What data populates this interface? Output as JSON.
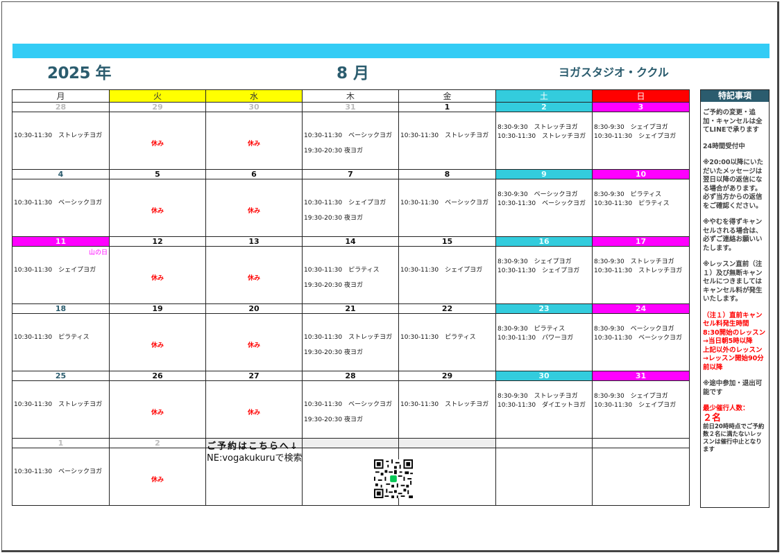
{
  "header": {
    "year": "2025 年",
    "month": "8 月",
    "studio": "ヨガスタジオ・ククル"
  },
  "weekdays": [
    "月",
    "火",
    "水",
    "木",
    "金",
    "土",
    "日"
  ],
  "weeks": [
    {
      "dates": [
        "28",
        "29",
        "30",
        "31",
        "1",
        "2",
        "3"
      ],
      "holiday": "",
      "cells": [
        {
          "l1": "10:30-11:30　ストレッチヨガ"
        },
        {
          "rest": "休み"
        },
        {
          "rest": "休み"
        },
        {
          "l1": "10:30-11:30　ベーシックヨガ",
          "l2": "19:30-20:30 夜ヨガ"
        },
        {
          "l1": "10:30-11:30　ストレッチヨガ"
        },
        {
          "w1": "8:30-9:30　ストレッチヨガ",
          "w2": "10:30-11:30　ストレッチヨガ"
        },
        {
          "w1": "8:30-9:30　シェイプヨガ",
          "w2": "10:30-11:30　シェイプヨガ"
        }
      ]
    },
    {
      "dates": [
        "4",
        "5",
        "6",
        "7",
        "8",
        "9",
        "10"
      ],
      "holiday": "",
      "cells": [
        {
          "l1": "10:30-11:30　ベーシックヨガ"
        },
        {
          "rest": "休み"
        },
        {
          "rest": "休み"
        },
        {
          "l1": "10:30-11:30　シェイプヨガ",
          "l2": "19:30-20:30 夜ヨガ"
        },
        {
          "l1": "10:30-11:30　ベーシックヨガ"
        },
        {
          "w1": "8:30-9:30　ベーシックヨガ",
          "w2": "10:30-11:30　ベーシックヨガ"
        },
        {
          "w1": "8:30-9:30　ピラティス",
          "w2": "10:30-11:30　ピラティス"
        }
      ]
    },
    {
      "dates": [
        "11",
        "12",
        "13",
        "14",
        "15",
        "16",
        "17"
      ],
      "holiday": "山の日",
      "cells": [
        {
          "l1": "10:30-11:30　シェイプヨガ"
        },
        {
          "rest": "休み"
        },
        {
          "rest": "休み"
        },
        {
          "l1": "10:30-11:30　ピラティス",
          "l2": "19:30-20:30 夜ヨガ"
        },
        {
          "l1": "10:30-11:30　シェイプヨガ"
        },
        {
          "w1": "8:30-9:30　シェイプヨガ",
          "w2": "10:30-11:30　シェイプヨガ"
        },
        {
          "w1": "8:30-9:30　ストレッチヨガ",
          "w2": "10:30-11:30　ストレッチヨガ"
        }
      ]
    },
    {
      "dates": [
        "18",
        "19",
        "20",
        "21",
        "22",
        "23",
        "24"
      ],
      "holiday": "",
      "cells": [
        {
          "l1": "10:30-11:30　ピラティス"
        },
        {
          "rest": "休み"
        },
        {
          "rest": "休み"
        },
        {
          "l1": "10:30-11:30　ストレッチヨガ",
          "l2": "19:30-20:30 夜ヨガ"
        },
        {
          "l1": "10:30-11:30　ピラティス"
        },
        {
          "w1": "8:30-9:30　ピラティス",
          "w2": "10:30-11:30　パワーヨガ"
        },
        {
          "w1": "8:30-9:30　ベーシックヨガ",
          "w2": "10:30-11:30　ベーシックヨガ"
        }
      ]
    },
    {
      "dates": [
        "25",
        "26",
        "27",
        "28",
        "29",
        "30",
        "31"
      ],
      "holiday": "",
      "cells": [
        {
          "l1": "10:30-11:30　ストレッチヨガ"
        },
        {
          "rest": "休み"
        },
        {
          "rest": "休み"
        },
        {
          "l1": "10:30-11:30　ベーシックヨガ",
          "l2": "19:30-20:30 夜ヨガ"
        },
        {
          "l1": "10:30-11:30　ストレッチヨガ"
        },
        {
          "w1": "8:30-9:30　ストレッチヨガ",
          "w2": "10:30-11:30　ダイエットヨガ"
        },
        {
          "w1": "8:30-9:30　シェイプヨガ",
          "w2": "10:30-11:30　シェイプヨガ"
        }
      ]
    },
    {
      "dates": [
        "1",
        "2",
        "",
        "",
        "",
        "",
        ""
      ],
      "holiday": "",
      "cells": [
        {
          "l1": "10:30-11:30　ベーシックヨガ"
        },
        {
          "rest": "休み"
        },
        {},
        {},
        {},
        {},
        {}
      ]
    }
  ],
  "booking": {
    "title": "ご予約はこちらへ↓",
    "line_search": "NE:vogakukuruで検索"
  },
  "notes": {
    "title": "特記事項",
    "p1": "ご予約の変更・追加・キャンセルは全てLINEで承ります",
    "p2": "24時間受付中",
    "p3": "※20:00以降にいただいたメッセージは翌日以降の返信になる場合があります。必ず当方からの返信をご確認ください。",
    "p4": "※やむを得ずキャンセルされる場合は、必ずご連絡お願いいたします。",
    "p5": "※レッスン直前（注１）及び無断キャンセルにつきましてはキャンセル料が発生いたします。",
    "p6": "（注１）直前キャンセル料発生時間",
    "p7": "8:30開始のレッスン→当日朝5時以降",
    "p8": "上記以外のレッスン→レッスン開始90分前以降",
    "p9": "※途中参加・退出可能です",
    "p10": "最少催行人数：",
    "p11": "２名",
    "p12": "前日20時時点でご予約数２名に満たないレッスンは催行中止となります"
  }
}
